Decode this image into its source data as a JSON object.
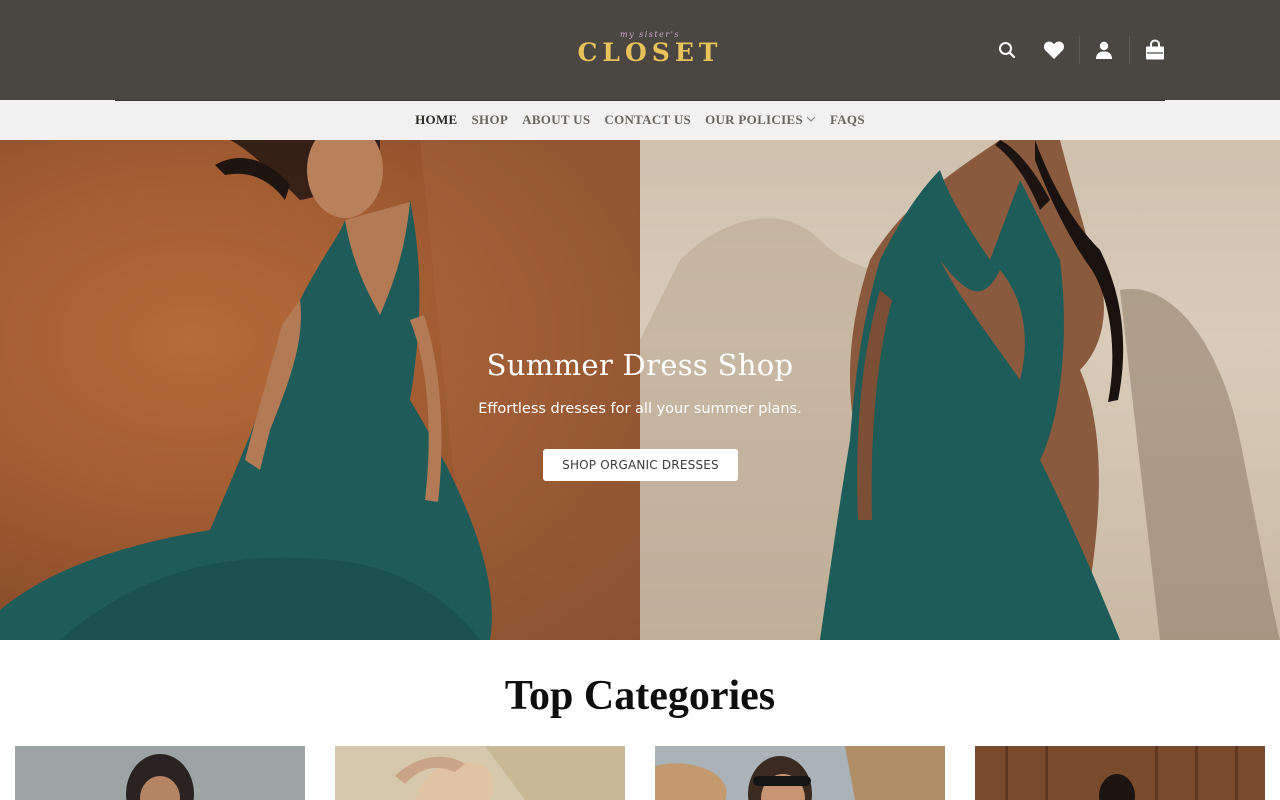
{
  "brand": {
    "tagline": "my sister's",
    "name": "CLOSET",
    "tagline_color": "#c9a8c9",
    "name_color": "#e8c25a"
  },
  "header": {
    "background": "#4a4641",
    "icons": [
      "search-icon",
      "heart-icon",
      "user-icon",
      "shopping-bag-icon"
    ]
  },
  "nav": {
    "items": [
      {
        "label": "HOME",
        "active": true
      },
      {
        "label": "SHOP"
      },
      {
        "label": "ABOUT US"
      },
      {
        "label": "CONTACT US"
      },
      {
        "label": "OUR POLICIES",
        "has_dropdown": true
      },
      {
        "label": "FAQS"
      }
    ]
  },
  "hero": {
    "title": "Summer Dress Shop",
    "subtitle": "Effortless dresses for all your summer plans.",
    "cta_label": "SHOP ORGANIC DRESSES"
  },
  "categories": {
    "title": "Top Categories"
  }
}
